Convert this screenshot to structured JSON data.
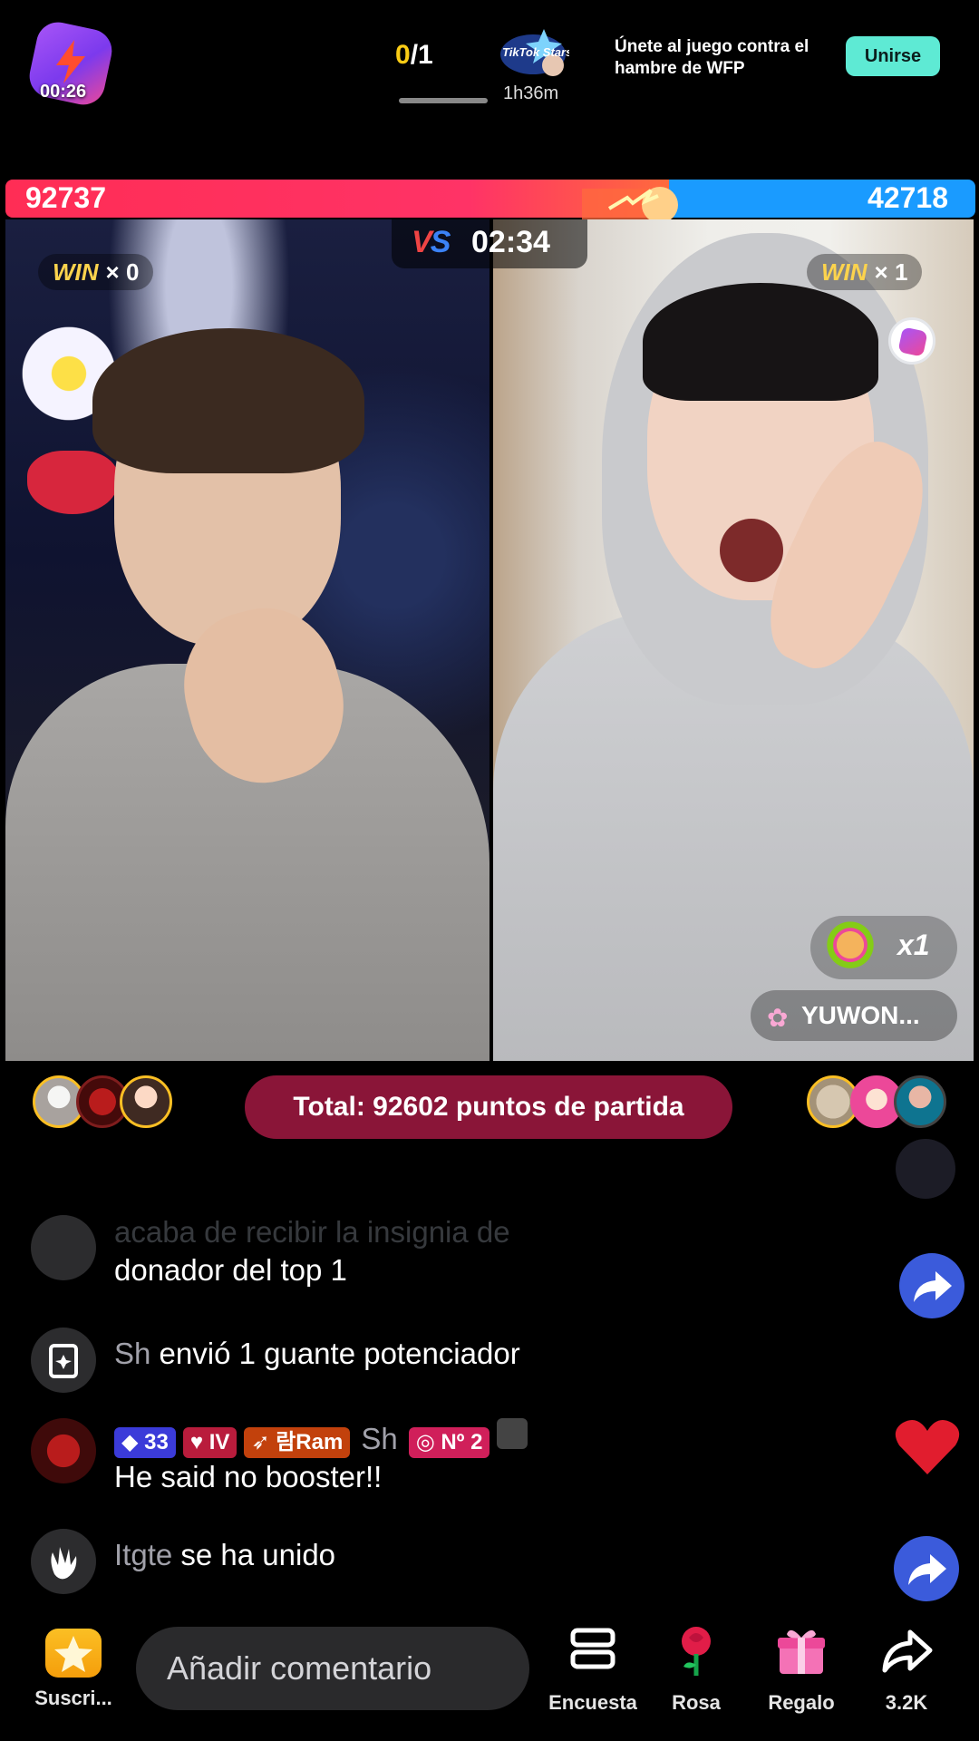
{
  "top": {
    "live_timer": "00:26",
    "counter_current": "0",
    "counter_total": "/1",
    "stars_logo_text": "TikTok Stars",
    "stars_time": "1h36m",
    "promo_text": "Únete al juego contra el hambre de WFP",
    "join_label": "Unirse"
  },
  "battle": {
    "red_score": "92737",
    "blue_score": "42718",
    "red_share": 0.684,
    "vs_label": "VS",
    "timer": "02:34",
    "left_win_label": "WIN",
    "left_win_count": "× 0",
    "right_win_label": "WIN",
    "right_win_count": "× 1",
    "colors": {
      "red": "#ff2d55",
      "blue": "#1a9bff"
    }
  },
  "stream": {
    "gift_combo": "x1",
    "host_name": "YUWON...",
    "total_label": "Total: 92602 puntos de partida"
  },
  "chat": {
    "faded_line": "acaba de recibir la insignia de",
    "msg1_text": "donador del top 1",
    "msg2_user": "Sh",
    "msg2_text": " envió 1 guante potenciador",
    "msg3_level": "33",
    "msg3_fan": "IV",
    "msg3_team": "람Ram",
    "msg3_user": "Sh",
    "msg3_rank": "Nº 2",
    "msg3_text": "He said no booster!!",
    "msg4_user": "Itgte",
    "msg4_text": " se ha unido"
  },
  "bottom": {
    "subscribe_label": "Suscri...",
    "comment_placeholder": "Añadir comentario",
    "poll_label": "Encuesta",
    "rose_label": "Rosa",
    "gift_label": "Regalo",
    "share_count": "3.2K"
  }
}
